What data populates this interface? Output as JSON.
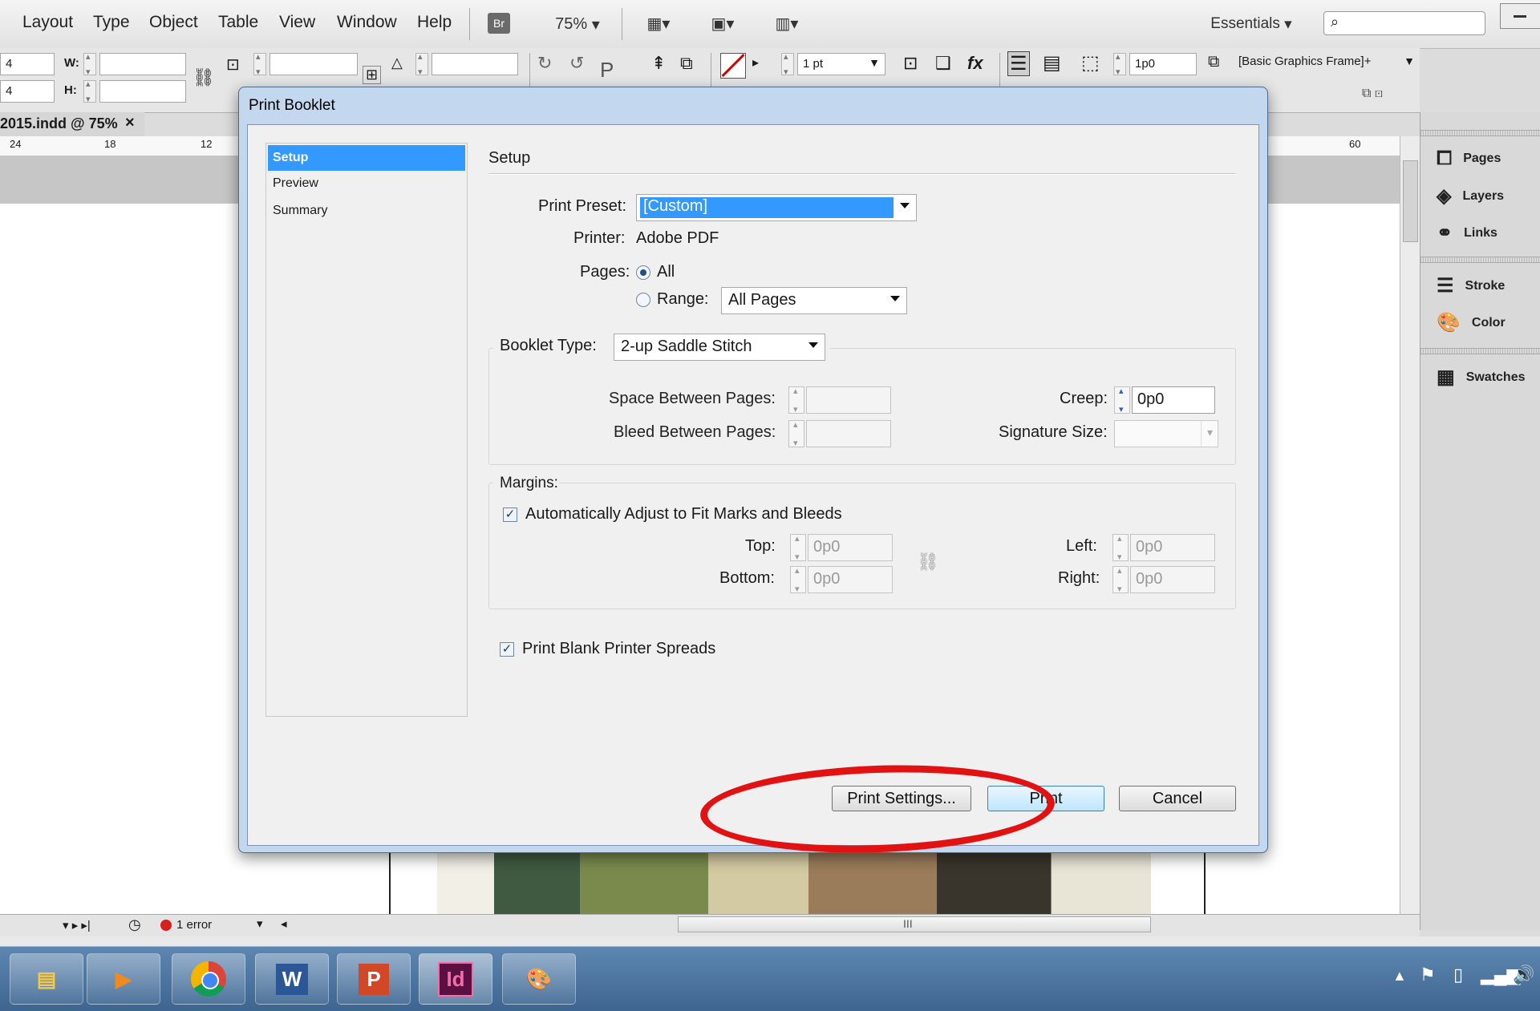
{
  "menubar": {
    "items": [
      "Layout",
      "Type",
      "Object",
      "Table",
      "View",
      "Window",
      "Help"
    ],
    "br_label": "Br",
    "zoom": "75%",
    "workspace": "Essentials",
    "search_placeholder": ""
  },
  "controlbar": {
    "x_value": "4",
    "y_value": "4",
    "w_label": "W:",
    "h_label": "H:",
    "stroke_weight": "1 pt",
    "offset_value": "1p0",
    "object_style": "[Basic Graphics Frame]+"
  },
  "document": {
    "tab_title": "2015.indd @ 75%",
    "tab_close": "×",
    "ruler_ticks": [
      "24",
      "18",
      "12"
    ],
    "ruler_right_tick": "60"
  },
  "right_panel": {
    "items": [
      "Pages",
      "Layers",
      "Links",
      "Stroke",
      "Color",
      "Swatches"
    ]
  },
  "statusbar": {
    "error_text": "1 error",
    "scroll_grip": "III"
  },
  "dialog": {
    "title": "Print Booklet",
    "nav": [
      "Setup",
      "Preview",
      "Summary"
    ],
    "section_title": "Setup",
    "print_preset_label": "Print Preset:",
    "print_preset_value": "[Custom]",
    "printer_label": "Printer:",
    "printer_value": "Adobe PDF",
    "pages_label": "Pages:",
    "pages_all": "All",
    "pages_range": "Range:",
    "range_value": "All Pages",
    "booklet_type_label": "Booklet Type:",
    "booklet_type_value": "2-up Saddle Stitch",
    "space_between_label": "Space Between Pages:",
    "bleed_between_label": "Bleed Between Pages:",
    "creep_label": "Creep:",
    "creep_value": "0p0",
    "signature_label": "Signature Size:",
    "margins_label": "Margins:",
    "auto_adjust_label": "Automatically Adjust to Fit Marks and Bleeds",
    "auto_adjust_checked": true,
    "top_label": "Top:",
    "top_value": "0p0",
    "bottom_label": "Bottom:",
    "bottom_value": "0p0",
    "left_label": "Left:",
    "left_value": "0p0",
    "right_label": "Right:",
    "right_value": "0p0",
    "blank_spreads_label": "Print Blank Printer Spreads",
    "blank_spreads_checked": true,
    "print_settings_button": "Print Settings...",
    "print_button": "Print",
    "cancel_button": "Cancel"
  },
  "taskbar": {
    "apps": [
      "file-explorer-icon",
      "media-player-icon",
      "chrome-icon",
      "word-icon",
      "powerpoint-icon",
      "indesign-icon",
      "paint-icon"
    ],
    "word_label": "W",
    "ppt_label": "P",
    "id_label": "Id"
  },
  "colors": {
    "selection": "#3399ff",
    "annotation": "#e21212",
    "taskbar": "#3d6590"
  }
}
